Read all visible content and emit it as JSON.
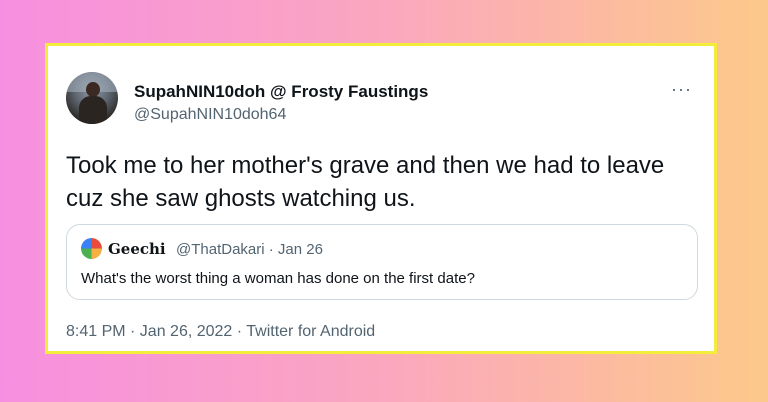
{
  "tweet": {
    "display_name": "SupahNIN10doh @ Frosty Faustings",
    "handle": "@SupahNIN10doh64",
    "more_icon": "more-horizontal-icon",
    "more_label": "···",
    "text": "Took me to her mother's grave and then we had to leave cuz she saw ghosts watching us.",
    "timestamp": "8:41 PM · Jan 26, 2022 · Twitter for Android"
  },
  "quote": {
    "display_name": "Geechi",
    "meta": "@ThatDakari · Jan 26",
    "text": "What's the worst thing a woman has done on the first date?"
  },
  "colors": {
    "card_border": "#f3ec3c",
    "gradient_left": "#f78fe0",
    "gradient_right": "#fcc98a",
    "text_primary": "#0f1419",
    "text_secondary": "#536471"
  }
}
